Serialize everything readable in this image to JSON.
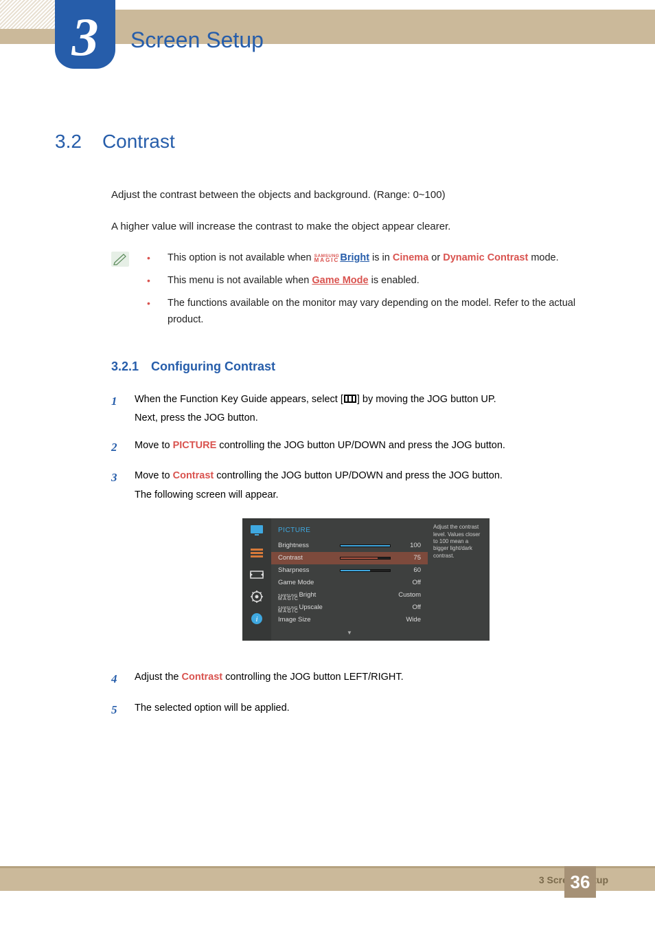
{
  "chapter": {
    "number": "3",
    "title": "Screen Setup"
  },
  "section": {
    "number": "3.2",
    "title": "Contrast",
    "intro1": "Adjust the contrast between the objects and background. (Range: 0~100)",
    "intro2": "A higher value will increase the contrast to make the object appear clearer."
  },
  "notes": {
    "samsung_small": "SAMSUNG",
    "magic_small": "MAGIC",
    "bright_link": "Bright",
    "b1_pre": "This option is not available when ",
    "b1_mid": " is in ",
    "b1_cinema": "Cinema",
    "b1_or": " or ",
    "b1_dyn": "Dynamic Contrast",
    "b1_post": " mode.",
    "b2_pre": "This menu is not available when ",
    "b2_link": "Game Mode",
    "b2_post": " is enabled.",
    "b3": "The functions available on the monitor may vary depending on the model. Refer to the actual product."
  },
  "subsection": {
    "number": "3.2.1",
    "title": "Configuring Contrast"
  },
  "steps": {
    "s1_pre": "When the Function Key Guide appears, select [",
    "s1_post": "] by moving the JOG button UP.",
    "s1_line2": "Next, press the JOG button.",
    "s2_pre": "Move to ",
    "s2_pic": "PICTURE",
    "s2_post": " controlling the JOG button UP/DOWN and press the JOG button.",
    "s3_pre": "Move to ",
    "s3_con": "Contrast",
    "s3_post": " controlling the JOG button UP/DOWN and press the JOG button.",
    "s3_line2": "The following screen will appear.",
    "s4_pre": "Adjust the ",
    "s4_con": "Contrast",
    "s4_post": " controlling the JOG button LEFT/RIGHT.",
    "s5": "The selected option will be applied."
  },
  "step_nums": {
    "n1": "1",
    "n2": "2",
    "n3": "3",
    "n4": "4",
    "n5": "5"
  },
  "osd": {
    "header": "PICTURE",
    "rows": [
      {
        "label": "Brightness",
        "type": "bar",
        "value": 100,
        "fill": 100
      },
      {
        "label": "Contrast",
        "type": "bar",
        "value": 75,
        "fill": 75,
        "selected": true
      },
      {
        "label": "Sharpness",
        "type": "bar",
        "value": 60,
        "fill": 60
      },
      {
        "label": "Game Mode",
        "type": "text",
        "value": "Off"
      },
      {
        "label": "MAGIC_Bright",
        "type": "text",
        "value": "Custom"
      },
      {
        "label": "MAGIC_Upscale",
        "type": "text",
        "value": "Off"
      },
      {
        "label": "Image Size",
        "type": "text",
        "value": "Wide"
      }
    ],
    "magic_bright_suffix": "Bright",
    "magic_upscale_suffix": "Upscale",
    "side_text": "Adjust the contrast level. Values closer to 100 mean a bigger light/dark contrast."
  },
  "footer": {
    "text": "3 Screen Setup",
    "page": "36"
  }
}
